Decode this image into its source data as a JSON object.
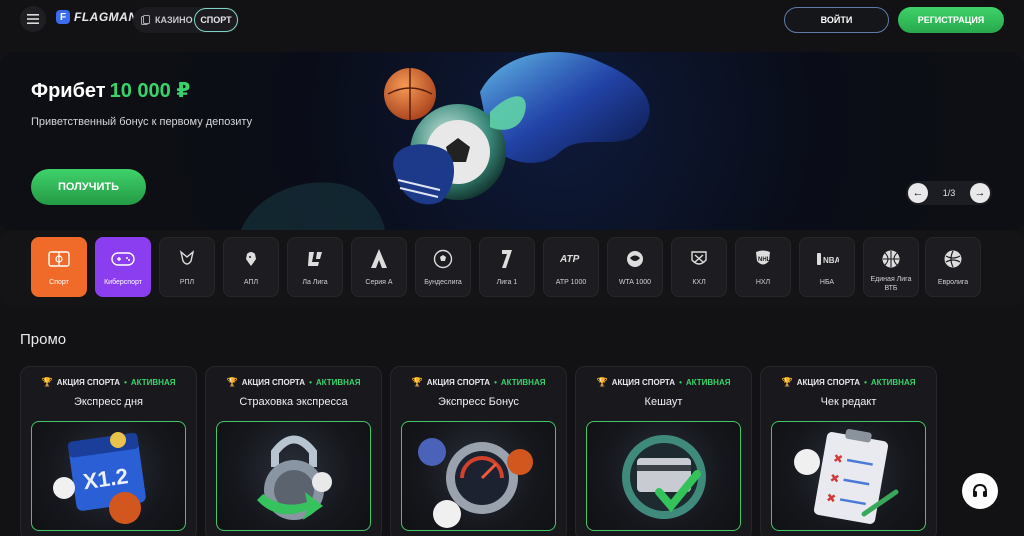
{
  "header": {
    "logo_letter": "F",
    "logo_text": "FLAGMAN",
    "mode_casino": "КАЗИНО",
    "mode_sport": "СПОРТ",
    "login": "ВОЙТИ",
    "register": "РЕГИСТРАЦИЯ"
  },
  "hero": {
    "title": "Фрибет",
    "amount": "10 000 ₽",
    "subtitle": "Приветственный бонус к первому депозиту",
    "cta": "ПОЛУЧИТЬ",
    "pager": "1/3"
  },
  "categories": [
    {
      "label": "Спорт",
      "icon": "soccer-field-icon"
    },
    {
      "label": "Киберспорт",
      "icon": "gamepad-icon"
    },
    {
      "label": "РПЛ",
      "icon": "rpl-icon"
    },
    {
      "label": "АПЛ",
      "icon": "premier-league-lion-icon"
    },
    {
      "label": "Ла Лига",
      "icon": "laliga-icon"
    },
    {
      "label": "Серия А",
      "icon": "serie-a-icon"
    },
    {
      "label": "Бундеслига",
      "icon": "soccer-ball-icon"
    },
    {
      "label": "Лига 1",
      "icon": "ligue1-icon"
    },
    {
      "label": "ATP 1000",
      "icon": "atp-tour-icon"
    },
    {
      "label": "WTA 1000",
      "icon": "wta-icon"
    },
    {
      "label": "КХЛ",
      "icon": "khl-icon"
    },
    {
      "label": "НХЛ",
      "icon": "nhl-shield-icon"
    },
    {
      "label": "НБА",
      "icon": "nba-icon"
    },
    {
      "label": "Единая Лига ВТБ",
      "icon": "vtb-league-icon"
    },
    {
      "label": "Евролига",
      "icon": "euroleague-icon"
    }
  ],
  "promo": {
    "title": "Промо",
    "cards": [
      {
        "kind": "АКЦИЯ СПОРТА",
        "status": "АКТИВНАЯ",
        "name": "Экспресс дня",
        "art_text": "X1.2"
      },
      {
        "kind": "АКЦИЯ СПОРТА",
        "status": "АКТИВНАЯ",
        "name": "Страховка экспресса"
      },
      {
        "kind": "АКЦИЯ СПОРТА",
        "status": "АКТИВНАЯ",
        "name": "Экспресс Бонус"
      },
      {
        "kind": "АКЦИЯ СПОРТА",
        "status": "АКТИВНАЯ",
        "name": "Кешаут"
      },
      {
        "kind": "АКЦИЯ СПОРТА",
        "status": "АКТИВНАЯ",
        "name": "Чек редакт"
      }
    ]
  },
  "colors": {
    "accent_green": "#39d36b",
    "sport_orange": "#f06a2a",
    "esport_purple": "#8a3ef0",
    "trophy_orange": "#e07a2c"
  }
}
